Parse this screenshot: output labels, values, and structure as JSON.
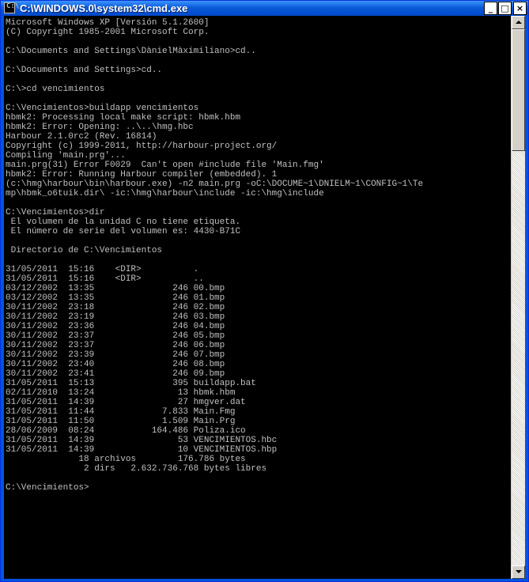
{
  "window": {
    "title": "C:\\WINDOWS.0\\system32\\cmd.exe",
    "buttons": {
      "minimize": "_",
      "maximize": "□",
      "close": "×"
    },
    "colors": {
      "titlebar": "#0a5bd8",
      "console_bg": "#000000",
      "console_fg": "#c0c0c0"
    }
  },
  "console": {
    "lines": [
      "Microsoft Windows XP [Versión 5.1.2600]",
      "(C) Copyright 1985-2001 Microsoft Corp.",
      "",
      "C:\\Documents and Settings\\DànielMàximiliano>cd..",
      "",
      "C:\\Documents and Settings>cd..",
      "",
      "C:\\>cd vencimientos",
      "",
      "C:\\Vencimientos>buildapp vencimientos",
      "hbmk2: Processing local make script: hbmk.hbm",
      "hbmk2: Error: Opening: ..\\..\\hmg.hbc",
      "Harbour 2.1.0rc2 (Rev. 16814)",
      "Copyright (c) 1999-2011, http://harbour-project.org/",
      "Compiling 'main.prg'...",
      "main.prg(31) Error F0029  Can't open #include file 'Main.fmg'",
      "hbmk2: Error: Running Harbour compiler (embedded). 1",
      "(c:\\hmg\\harbour\\bin\\harbour.exe) -n2 main.prg -oC:\\DOCUME~1\\DNIELM~1\\CONFIG~1\\Te",
      "mp\\hbmk_o6tuik.dir\\ -ic:\\hmg\\harbour\\include -ic:\\hmg\\include",
      "",
      "C:\\Vencimientos>dir",
      " El volumen de la unidad C no tiene etiqueta.",
      " El número de serie del volumen es: 4430-B71C",
      "",
      " Directorio de C:\\Vencimientos",
      "",
      "31/05/2011  15:16    <DIR>          .",
      "31/05/2011  15:16    <DIR>          ..",
      "03/12/2002  13:35               246 00.bmp",
      "03/12/2002  13:35               246 01.bmp",
      "30/11/2002  23:18               246 02.bmp",
      "30/11/2002  23:19               246 03.bmp",
      "30/11/2002  23:36               246 04.bmp",
      "30/11/2002  23:37               246 05.bmp",
      "30/11/2002  23:37               246 06.bmp",
      "30/11/2002  23:39               246 07.bmp",
      "30/11/2002  23:40               246 08.bmp",
      "30/11/2002  23:41               246 09.bmp",
      "31/05/2011  15:13               395 buildapp.bat",
      "02/11/2010  13:24                13 hbmk.hbm",
      "31/05/2011  14:39                27 hmgver.dat",
      "31/05/2011  11:44             7.833 Main.Fmg",
      "31/05/2011  11:50             1.509 Main.Prg",
      "28/06/2009  08:24           164.486 Poliza.ico",
      "31/05/2011  14:39                53 VENCIMIENTOS.hbc",
      "31/05/2011  14:39                10 VENCIMIENTOS.hbp",
      "              18 archivos        176.786 bytes",
      "               2 dirs   2.632.736.768 bytes libres",
      "",
      "C:\\Vencimientos>"
    ]
  }
}
